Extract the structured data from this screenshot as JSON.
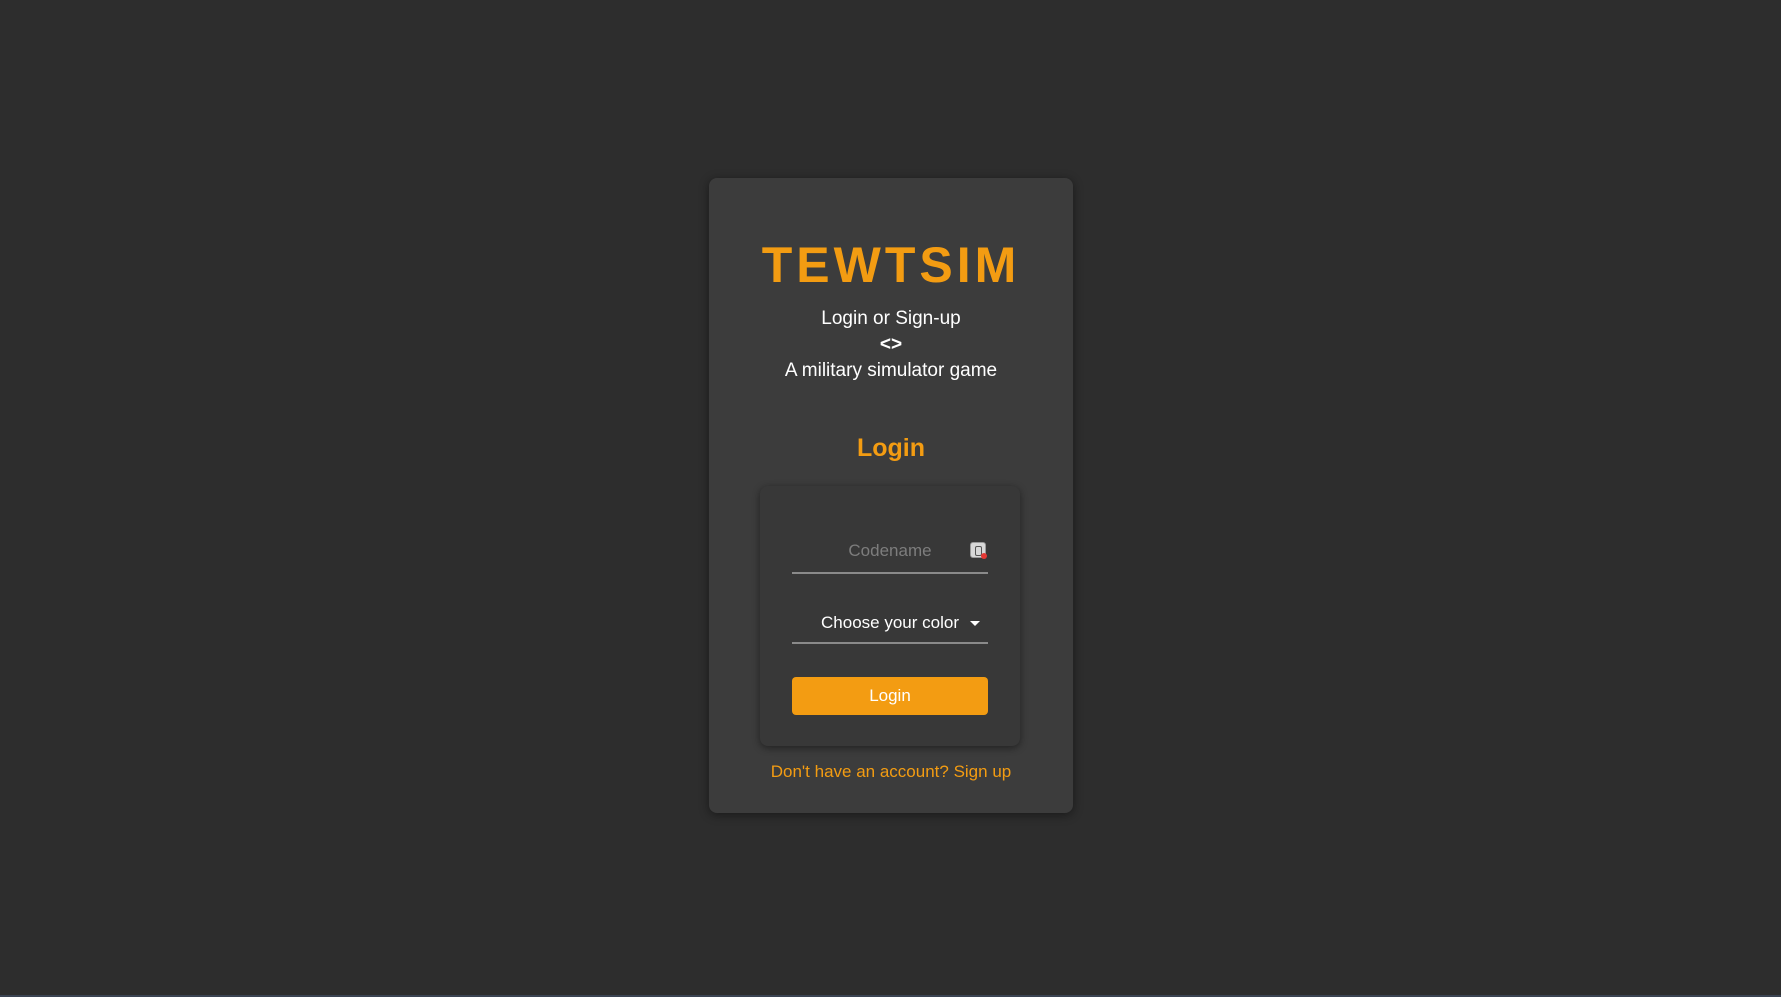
{
  "colors": {
    "background": "#2d2d2d",
    "card": "#3c3c3c",
    "form_box": "#383838",
    "accent": "#f39c12",
    "text": "#ffffff",
    "placeholder": "#7d7d7d"
  },
  "header": {
    "app_title": "TEWTSIM",
    "subtitle_line1": "Login or Sign-up",
    "subtitle_line2": "<>",
    "subtitle_line3": "A military simulator game"
  },
  "login": {
    "section_title": "Login",
    "codename_placeholder": "Codename",
    "codename_value": "",
    "codename_icon": "password-manager-key-icon",
    "color_select_value": "Choose your color",
    "color_select_icon": "caret-down-icon",
    "button_label": "Login"
  },
  "footer": {
    "signup_link": "Don't have an account? Sign up"
  }
}
